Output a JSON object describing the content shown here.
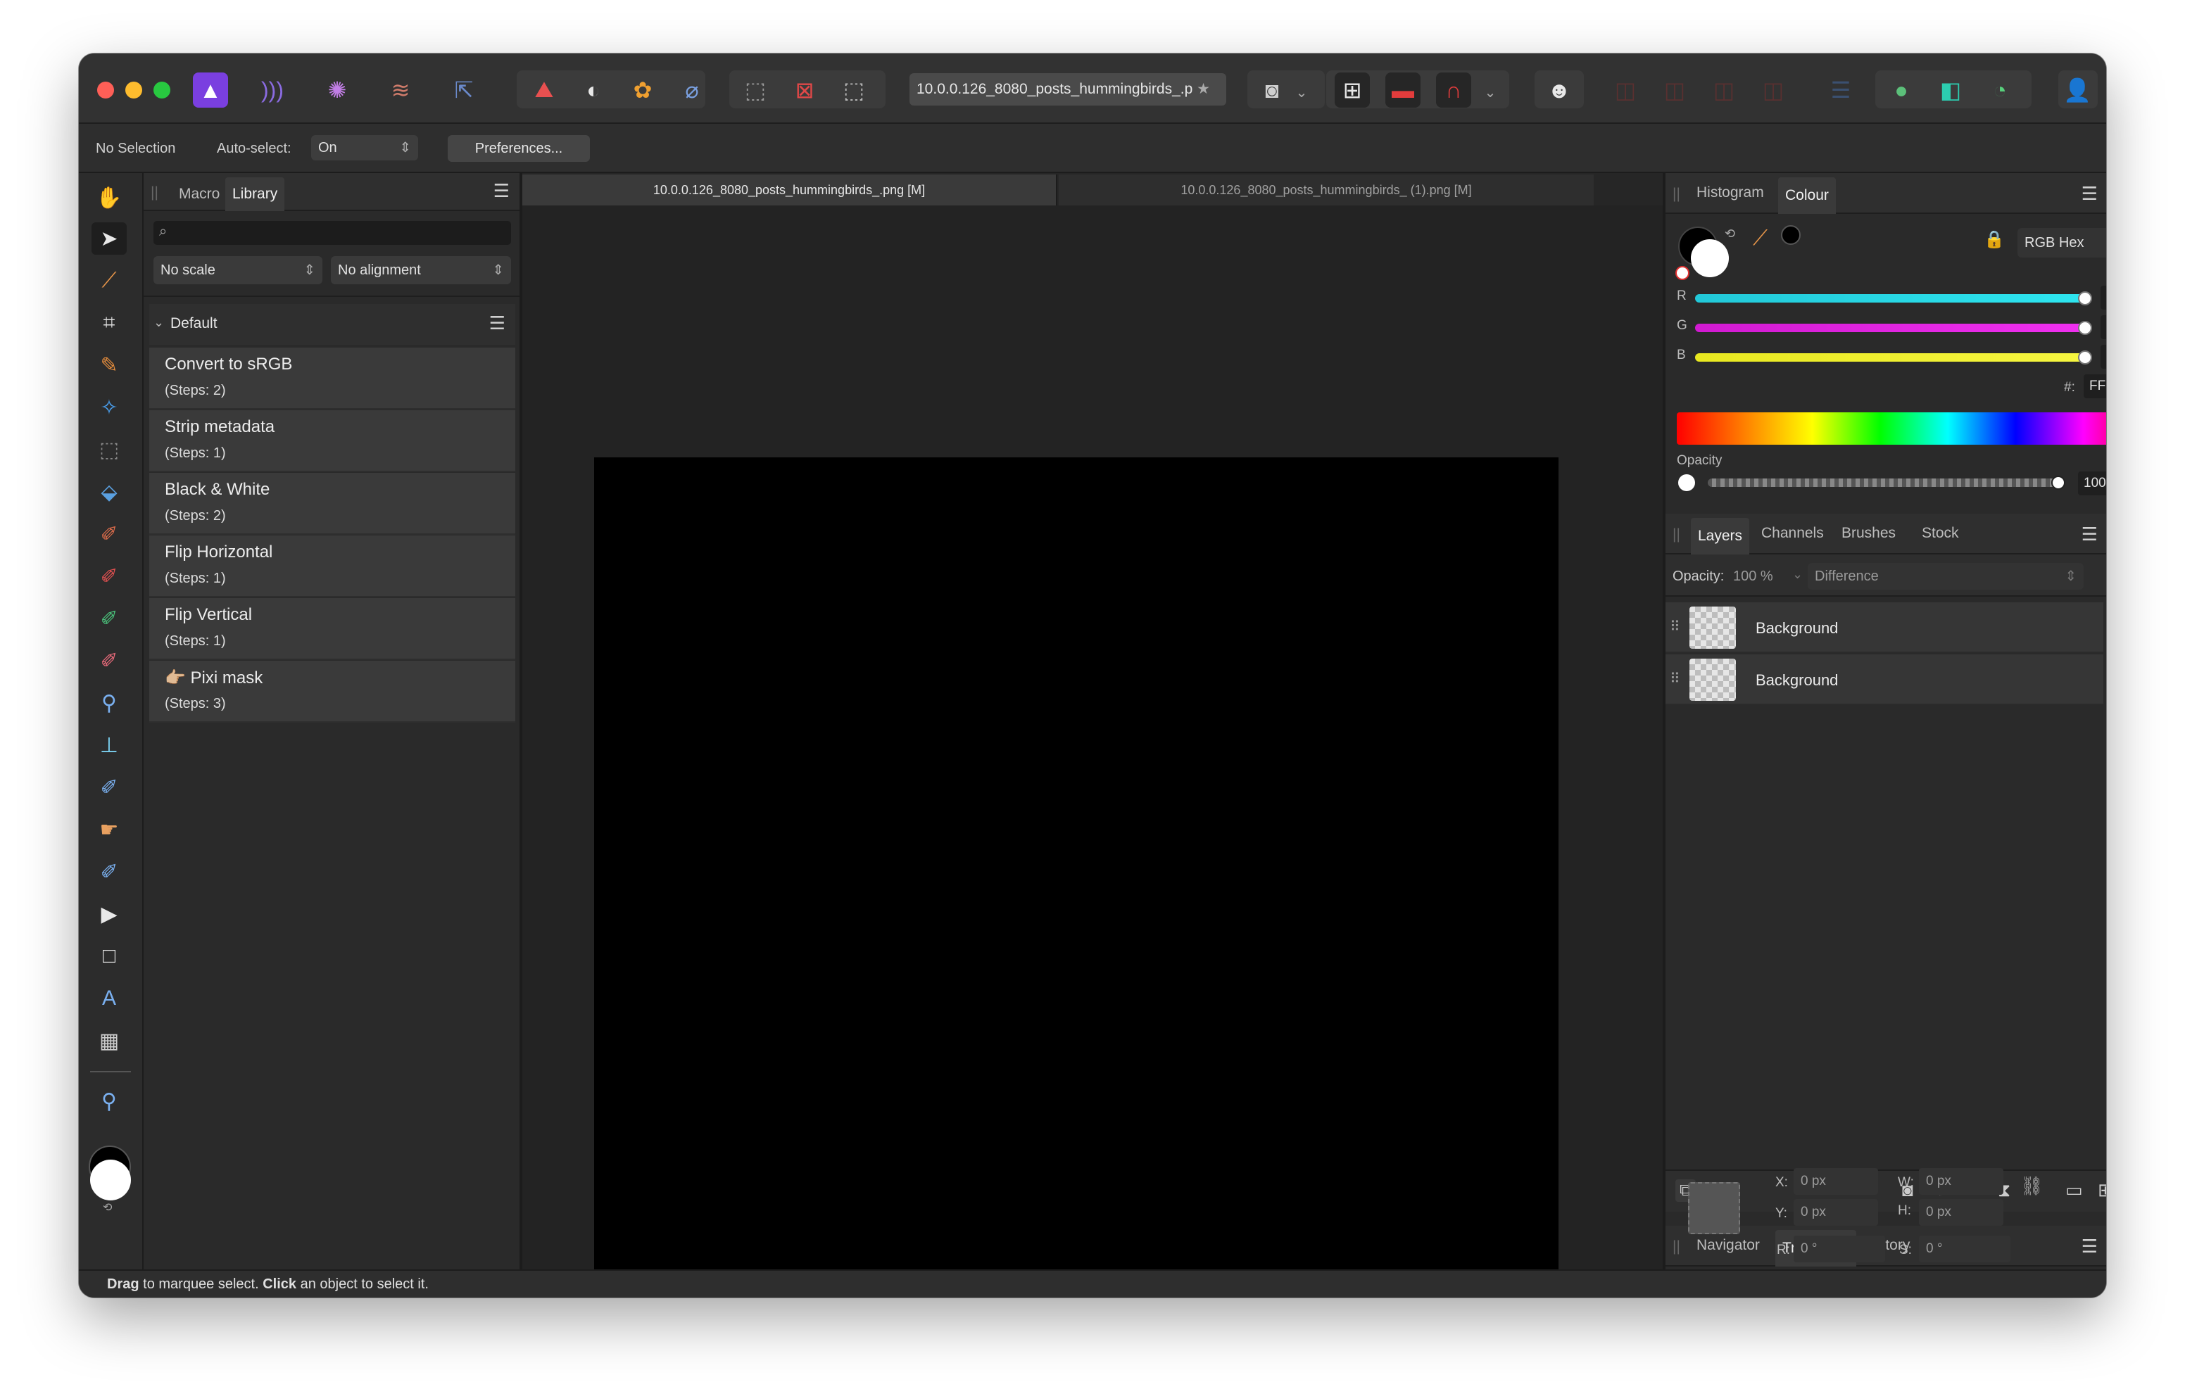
{
  "toolbar": {
    "document_field": "10.0.0.126_8080_posts_hummingbirds_.p",
    "document_field_star": "★"
  },
  "context_bar": {
    "selection_label": "No Selection",
    "auto_select_label": "Auto-select:",
    "auto_select_value": "On",
    "preferences_button": "Preferences..."
  },
  "left_panel": {
    "tabs": [
      "Macro",
      "Library"
    ],
    "active_tab": "Library",
    "search_placeholder": "",
    "scale_select": "No scale",
    "alignment_select": "No alignment",
    "category": "Default",
    "macros": [
      {
        "title": "Convert to sRGB",
        "steps": "(Steps: 2)"
      },
      {
        "title": "Strip metadata",
        "steps": "(Steps: 1)"
      },
      {
        "title": "Black & White",
        "steps": "(Steps: 2)"
      },
      {
        "title": "Flip Horizontal",
        "steps": "(Steps: 1)"
      },
      {
        "title": "Flip Vertical",
        "steps": "(Steps: 1)"
      },
      {
        "title": "👉🏼 Pixi mask",
        "steps": "(Steps: 3)"
      }
    ]
  },
  "document_tabs": [
    "10.0.0.126_8080_posts_hummingbirds_.png [M]",
    "10.0.0.126_8080_posts_hummingbirds_ (1).png [M]"
  ],
  "colour_panel": {
    "tabs": [
      "Histogram",
      "Colour"
    ],
    "active_tab": "Colour",
    "mode": "RGB Hex",
    "channels": [
      {
        "label": "R",
        "value": "FF"
      },
      {
        "label": "G",
        "value": "FF"
      },
      {
        "label": "B",
        "value": "FF"
      }
    ],
    "hex_label": "#:",
    "hex_value": "FFFFFF",
    "opacity_label": "Opacity",
    "opacity_value": "100 %",
    "colors": {
      "r": "#22d8e8",
      "g": "#e021e0",
      "b": "#f2f21c"
    }
  },
  "layers_panel": {
    "tabs": [
      "Layers",
      "Channels",
      "Brushes",
      "Stock"
    ],
    "active_tab": "Layers",
    "opacity_label": "Opacity:",
    "opacity_value": "100 %",
    "blend_mode": "Difference",
    "layers": [
      {
        "name": "Background",
        "locked": false
      },
      {
        "name": "Background",
        "locked": true
      }
    ]
  },
  "transform_panel": {
    "tabs": [
      "Navigator",
      "Transform",
      "History"
    ],
    "active_tab": "Transform",
    "fields": {
      "x_label": "X:",
      "x": "0 px",
      "y_label": "Y:",
      "y": "0 px",
      "w_label": "W:",
      "w": "0 px",
      "h_label": "H:",
      "h": "0 px",
      "r_label": "R:",
      "r": "0 °",
      "s_label": "S:",
      "s": "0 °"
    }
  },
  "status_bar": {
    "drag": "Drag",
    "drag_text": " to marquee select. ",
    "click": "Click",
    "click_text": " an object to select it."
  }
}
